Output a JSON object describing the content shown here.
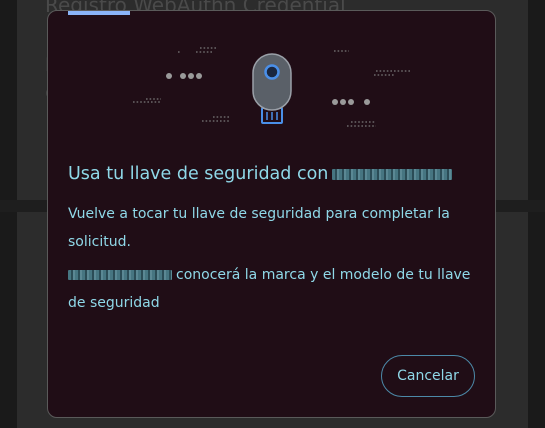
{
  "background": {
    "title_fragment": "Registro WebAuthn Credential"
  },
  "dialog": {
    "title_prefix": "Usa tu llave de seguridad con",
    "body_line_1": "Vuelve a tocar tu llave de seguridad para completar la solicitud.",
    "body_line_2_suffix": "conocerá la marca y el modelo de tu llave de seguridad",
    "cancel_label": "Cancelar",
    "illustration_icon": "usb-security-key-icon"
  },
  "colors": {
    "dialog_bg": "#200d16",
    "text_accent": "#8fd8e8",
    "progress_accent": "#8ab4f8",
    "key_accent": "#4a8fe8"
  }
}
